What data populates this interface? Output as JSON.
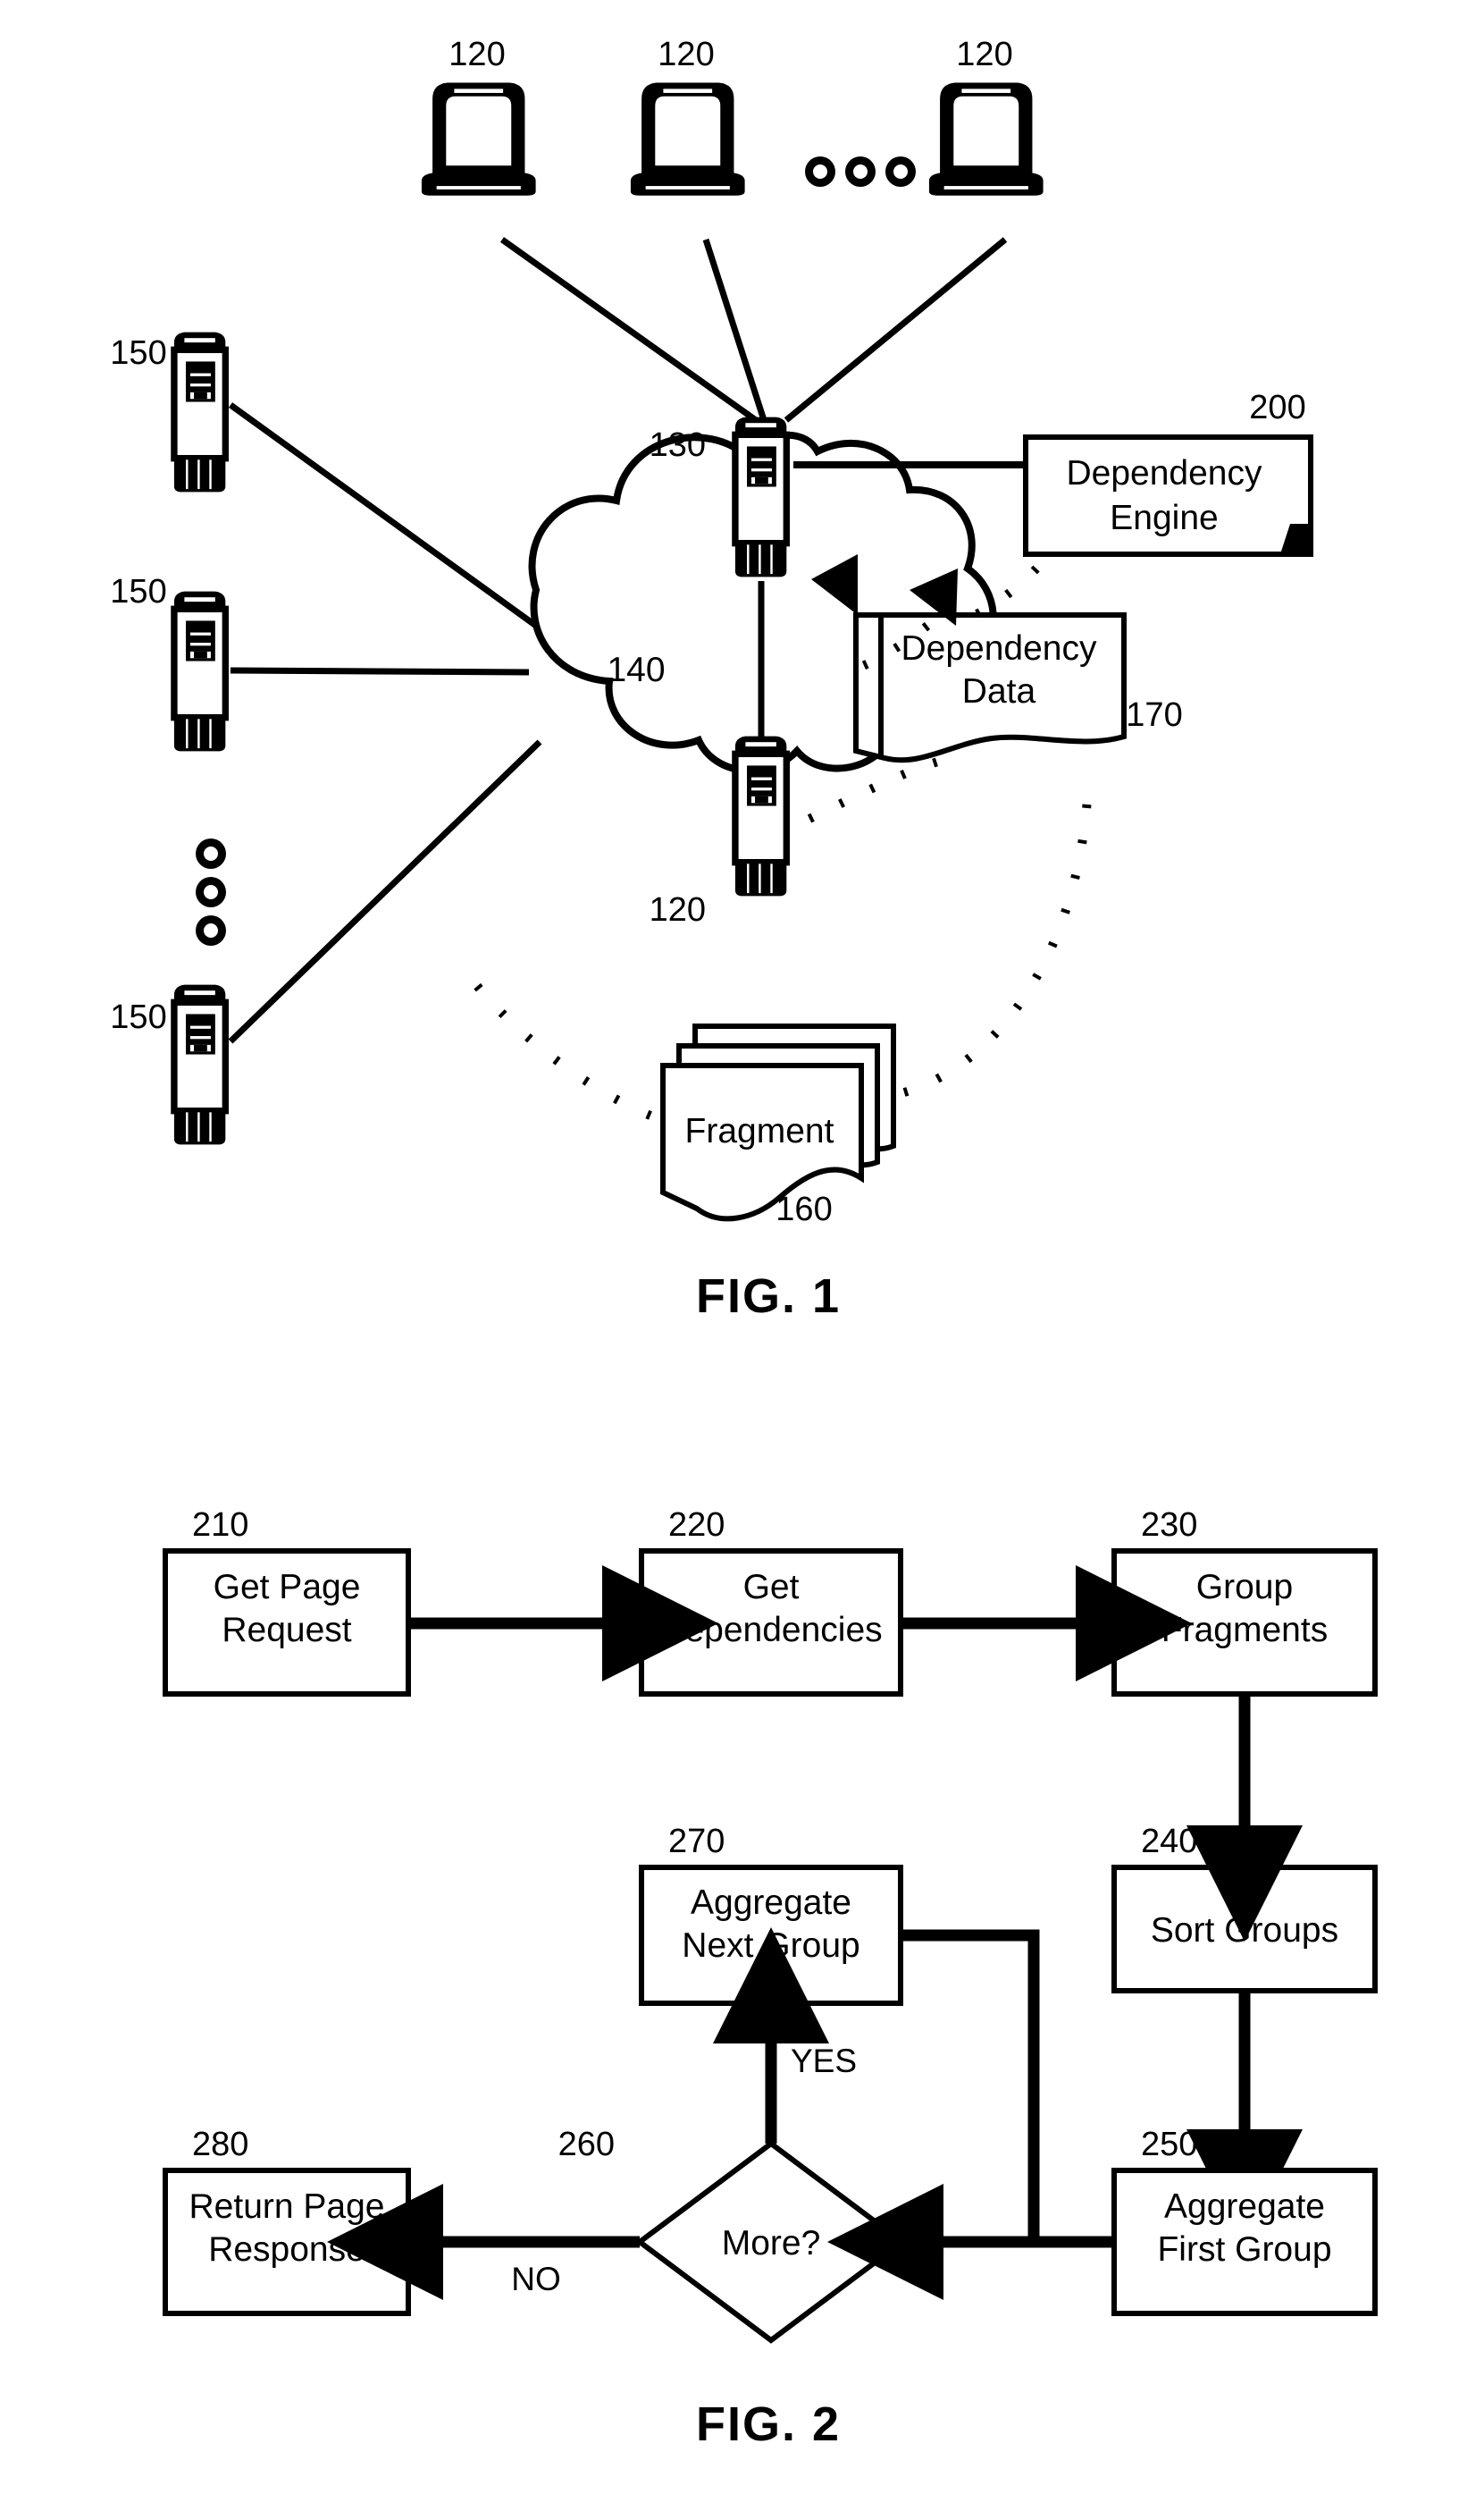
{
  "document": {
    "type": "patent-figure-sheet",
    "background_color": "#ffffff",
    "line_color": "#000000"
  },
  "figure1": {
    "title": "FIG. 1",
    "clients": [
      {
        "ref": "120",
        "icon": "laptop-icon"
      },
      {
        "ref": "120",
        "icon": "laptop-icon"
      },
      {
        "ref": "120",
        "icon": "laptop-icon"
      }
    ],
    "client_ellipsis": "ooo",
    "backend_servers": [
      {
        "ref": "150",
        "icon": "server-tower-icon"
      },
      {
        "ref": "150",
        "icon": "server-tower-icon"
      },
      {
        "ref": "150",
        "icon": "server-tower-icon"
      }
    ],
    "server_ellipsis": "ooo",
    "network": {
      "ref": "140",
      "icon": "cloud-icon"
    },
    "front_server": {
      "ref": "130",
      "icon": "server-tower-icon"
    },
    "second_server": {
      "ref": "120",
      "icon": "server-tower-icon"
    },
    "dependency_engine": {
      "ref": "200",
      "label_line1": "Dependency",
      "label_line2": "Engine"
    },
    "dependency_data": {
      "ref": "170",
      "label_line1": "Dependency",
      "label_line2": "Data"
    },
    "fragment": {
      "ref": "160",
      "label": "Fragment"
    }
  },
  "figure2": {
    "title": "FIG. 2",
    "nodes": [
      {
        "ref": "210",
        "shape": "process",
        "label_line1": "Get Page",
        "label_line2": "Request"
      },
      {
        "ref": "220",
        "shape": "process",
        "label_line1": "Get",
        "label_line2": "Dependencies"
      },
      {
        "ref": "230",
        "shape": "process",
        "label_line1": "Group",
        "label_line2": "Fragments"
      },
      {
        "ref": "240",
        "shape": "process",
        "label_line1": "Sort Groups",
        "label_line2": ""
      },
      {
        "ref": "250",
        "shape": "process",
        "label_line1": "Aggregate",
        "label_line2": "First Group"
      },
      {
        "ref": "260",
        "shape": "decision",
        "label_line1": "More?",
        "label_line2": ""
      },
      {
        "ref": "270",
        "shape": "process",
        "label_line1": "Aggregate",
        "label_line2": "Next Group"
      },
      {
        "ref": "280",
        "shape": "process",
        "label_line1": "Return Page",
        "label_line2": "Response"
      }
    ],
    "edge_labels": {
      "yes": "YES",
      "no": "NO"
    }
  }
}
